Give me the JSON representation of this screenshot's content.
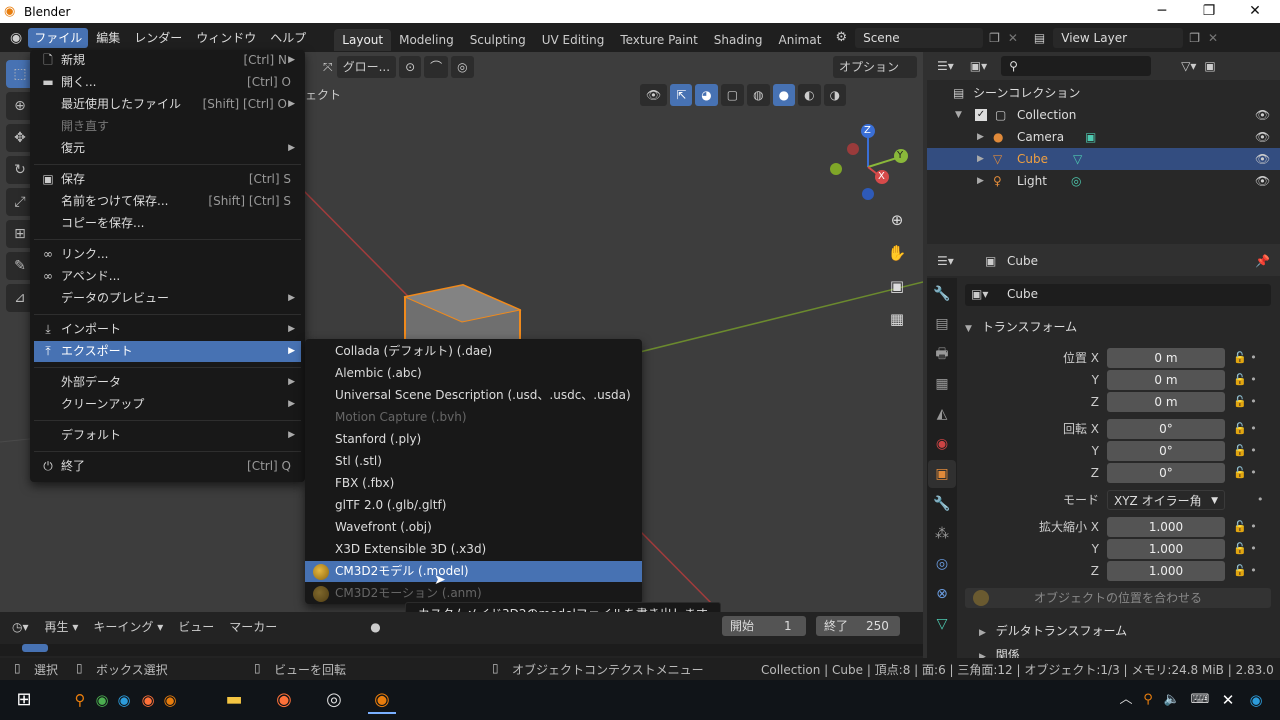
{
  "window": {
    "title": "Blender",
    "minimize": "─",
    "maximize": "❐",
    "close": "✕"
  },
  "topbar": {
    "menus": [
      "ファイル",
      "編集",
      "レンダー",
      "ウィンドウ",
      "ヘルプ"
    ],
    "workspaces": [
      "Layout",
      "Modeling",
      "Sculpting",
      "UV Editing",
      "Texture Paint",
      "Shading",
      "Animat"
    ],
    "scene": "Scene",
    "view_layer": "View Layer"
  },
  "viewport": {
    "orientation": "グロー...",
    "options": "オプション",
    "object_label": "ェクト",
    "axes": {
      "x": "X",
      "y": "Y",
      "z": "Z"
    }
  },
  "file_menu": {
    "items": [
      {
        "label": "新規",
        "shortcut": "[Ctrl] N",
        "icon": "new-file-icon",
        "arrow": true
      },
      {
        "label": "開く...",
        "shortcut": "[Ctrl] O",
        "icon": "open-folder-icon"
      },
      {
        "label": "最近使用したファイル",
        "shortcut": "[Shift] [Ctrl] O",
        "arrow": true
      },
      {
        "label": "開き直す",
        "dim": true
      },
      {
        "label": "復元",
        "arrow": true
      },
      {
        "label": "保存",
        "shortcut": "[Ctrl] S",
        "icon": "save-icon"
      },
      {
        "label": "名前をつけて保存...",
        "shortcut": "[Shift] [Ctrl] S"
      },
      {
        "label": "コピーを保存..."
      },
      {
        "label": "リンク...",
        "icon": "link-icon"
      },
      {
        "label": "アペンド...",
        "icon": "append-icon"
      },
      {
        "label": "データのプレビュー",
        "arrow": true
      },
      {
        "label": "インポート",
        "icon": "import-icon",
        "arrow": true
      },
      {
        "label": "エクスポート",
        "icon": "export-icon",
        "arrow": true
      },
      {
        "label": "外部データ",
        "arrow": true
      },
      {
        "label": "クリーンアップ",
        "arrow": true
      },
      {
        "label": "デフォルト",
        "arrow": true
      },
      {
        "label": "終了",
        "shortcut": "[Ctrl] Q",
        "icon": "power-icon"
      }
    ]
  },
  "export_menu": {
    "items": [
      "Collada (デフォルト) (.dae)",
      "Alembic (.abc)",
      "Universal Scene Description (.usd、.usdc、.usda)",
      "Motion Capture (.bvh)",
      "Stanford (.ply)",
      "Stl (.stl)",
      "FBX (.fbx)",
      "glTF 2.0 (.glb/.gltf)",
      "Wavefront (.obj)",
      "X3D Extensible 3D (.x3d)",
      "CM3D2モデル (.model)",
      "CM3D2モーション (.anm)"
    ],
    "tooltip": "カスタムメイド3D2のmodelファイルを書き出します。"
  },
  "outliner": {
    "root": "シーンコレクション",
    "collection": "Collection",
    "items": [
      "Camera",
      "Cube",
      "Light"
    ]
  },
  "properties": {
    "object_name": "Cube",
    "object_field": "Cube",
    "transform_header": "トランスフォーム",
    "location_label": "位置 X",
    "rotation_label": "回転 X",
    "mode_label": "モード",
    "mode_value": "XYZ オイラー角",
    "scale_label": "拡大縮小 X",
    "y_label": "Y",
    "z_label": "Z",
    "location": [
      "0 m",
      "0 m",
      "0 m"
    ],
    "rotation": [
      "0°",
      "0°",
      "0°"
    ],
    "scale": [
      "1.000",
      "1.000",
      "1.000"
    ],
    "align_button": "オブジェクトの位置を合わせる",
    "delta_header": "デルタトランスフォーム",
    "relations_header": "関係"
  },
  "timeline": {
    "play": "再生",
    "keying": "キーイング",
    "view": "ビュー",
    "marker": "マーカー",
    "start_label": "開始",
    "start": "1",
    "end_label": "終了",
    "end": "250"
  },
  "statusbar": {
    "select": "選択",
    "box_select": "ボックス選択",
    "rotate_view": "ビューを回転",
    "context_menu": "オブジェクトコンテクストメニュー",
    "info": "Collection | Cube | 頂点:8 | 面:6 | 三角面:12 | オブジェクト:1/3 | メモリ:24.8 MiB | 2.83.0"
  }
}
